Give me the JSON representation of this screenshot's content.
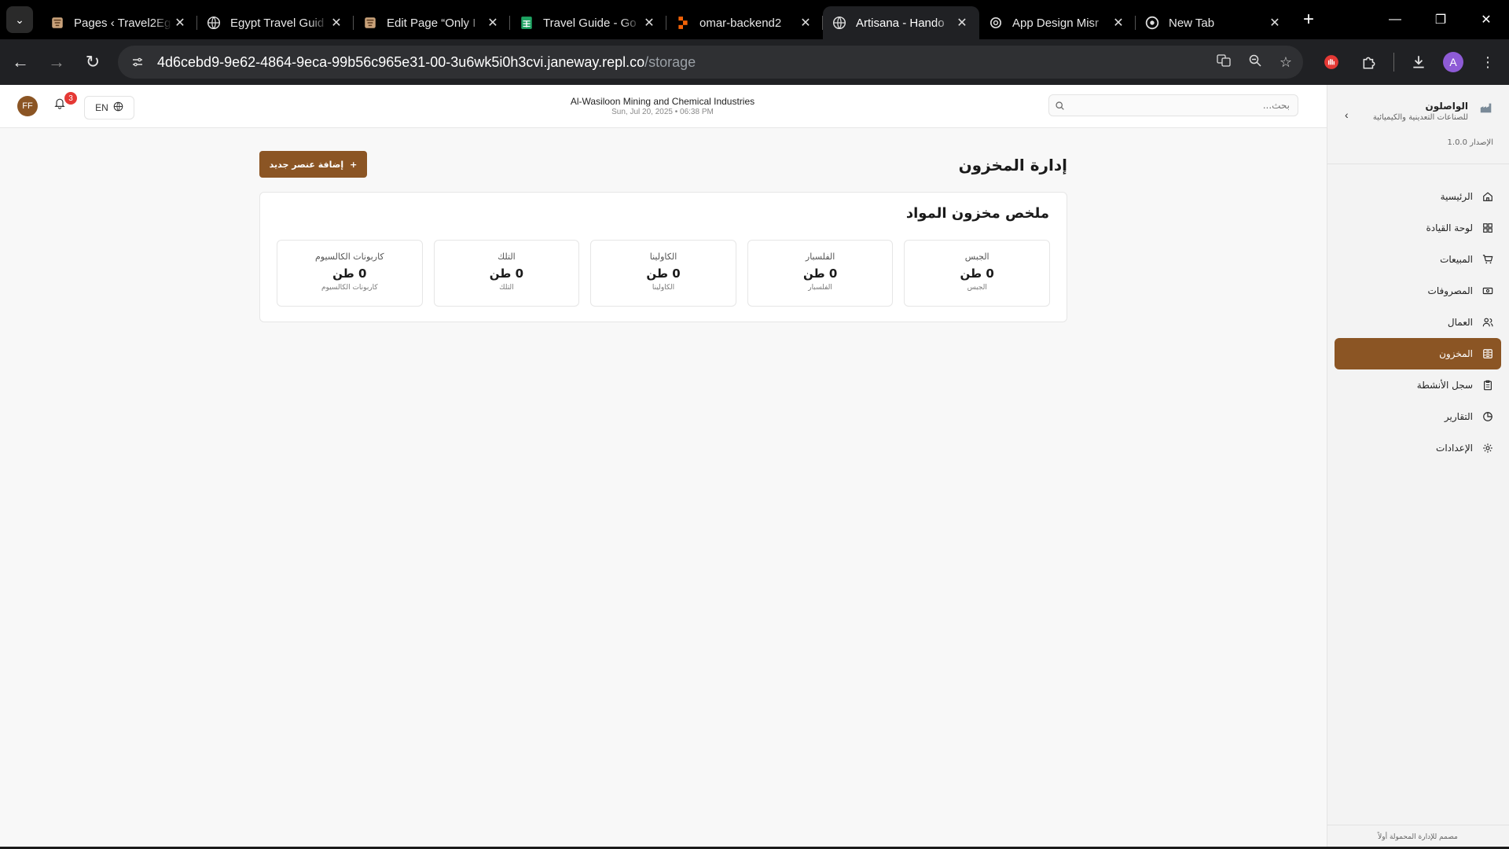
{
  "browser": {
    "tabs": [
      {
        "title": "Pages ‹ Travel2Eg",
        "icon": "wordpress-tab-icon",
        "active": false
      },
      {
        "title": "Egypt Travel Guid",
        "icon": "globe-tab-icon",
        "active": false
      },
      {
        "title": "Edit Page “Only I",
        "icon": "wordpress-tab-icon",
        "active": false
      },
      {
        "title": "Travel Guide - Go",
        "icon": "sheets-tab-icon",
        "active": false
      },
      {
        "title": "omar-backend2",
        "icon": "replit-tab-icon",
        "active": false
      },
      {
        "title": "Artisana - Hando",
        "icon": "globe-tab-icon",
        "active": true
      },
      {
        "title": "App Design Misr",
        "icon": "openai-tab-icon",
        "active": false
      },
      {
        "title": "New Tab",
        "icon": "chrome-tab-icon",
        "active": false
      }
    ],
    "url_host": "4d6cebd9-9e62-4864-9eca-99b56c965e31-00-3u6wk5i0h3cvi.janeway.repl.co",
    "url_path": "/storage",
    "profile_initial": "A"
  },
  "topbar": {
    "avatar_initials": "FF",
    "notification_count": "3",
    "language": "EN",
    "company_name": "Al-Wasiloon Mining and Chemical Industries",
    "datetime": "Sun, Jul 20, 2025 • 06:38 PM",
    "search_placeholder": "بحث..."
  },
  "sidebar": {
    "brand_name": "الواصلون",
    "brand_subtitle": "للصناعات التعدينية والكيميائية",
    "version": "الإصدار 1.0.0",
    "items": [
      {
        "label": "الرئيسية",
        "icon": "home-icon",
        "active": false
      },
      {
        "label": "لوحة القيادة",
        "icon": "dashboard-icon",
        "active": false
      },
      {
        "label": "المبيعات",
        "icon": "cart-icon",
        "active": false
      },
      {
        "label": "المصروفات",
        "icon": "money-icon",
        "active": false
      },
      {
        "label": "العمال",
        "icon": "users-icon",
        "active": false
      },
      {
        "label": "المخزون",
        "icon": "storage-icon",
        "active": true
      },
      {
        "label": "سجل الأنشطة",
        "icon": "clipboard-icon",
        "active": false
      },
      {
        "label": "التقارير",
        "icon": "pie-chart-icon",
        "active": false
      },
      {
        "label": "الإعدادات",
        "icon": "gear-icon",
        "active": false
      }
    ],
    "footer": "مصمم للإدارة المحمولة أولاً"
  },
  "main": {
    "title": "إدارة المخزون",
    "add_button": "إضافة عنصر جديد",
    "summary_title": "ملخص مخزون المواد",
    "materials": [
      {
        "name": "الجبس",
        "quantity": "0 طن",
        "subtitle": "الجبس"
      },
      {
        "name": "الفلسبار",
        "quantity": "0 طن",
        "subtitle": "الفلسبار"
      },
      {
        "name": "الكاولينا",
        "quantity": "0 طن",
        "subtitle": "الكاولينا"
      },
      {
        "name": "التلك",
        "quantity": "0 طن",
        "subtitle": "التلك"
      },
      {
        "name": "كاربونات الكالسيوم",
        "quantity": "0 طن",
        "subtitle": "كاربونات الكالسيوم"
      }
    ]
  },
  "colors": {
    "accent": "#8b5524",
    "badge": "#e53935"
  }
}
